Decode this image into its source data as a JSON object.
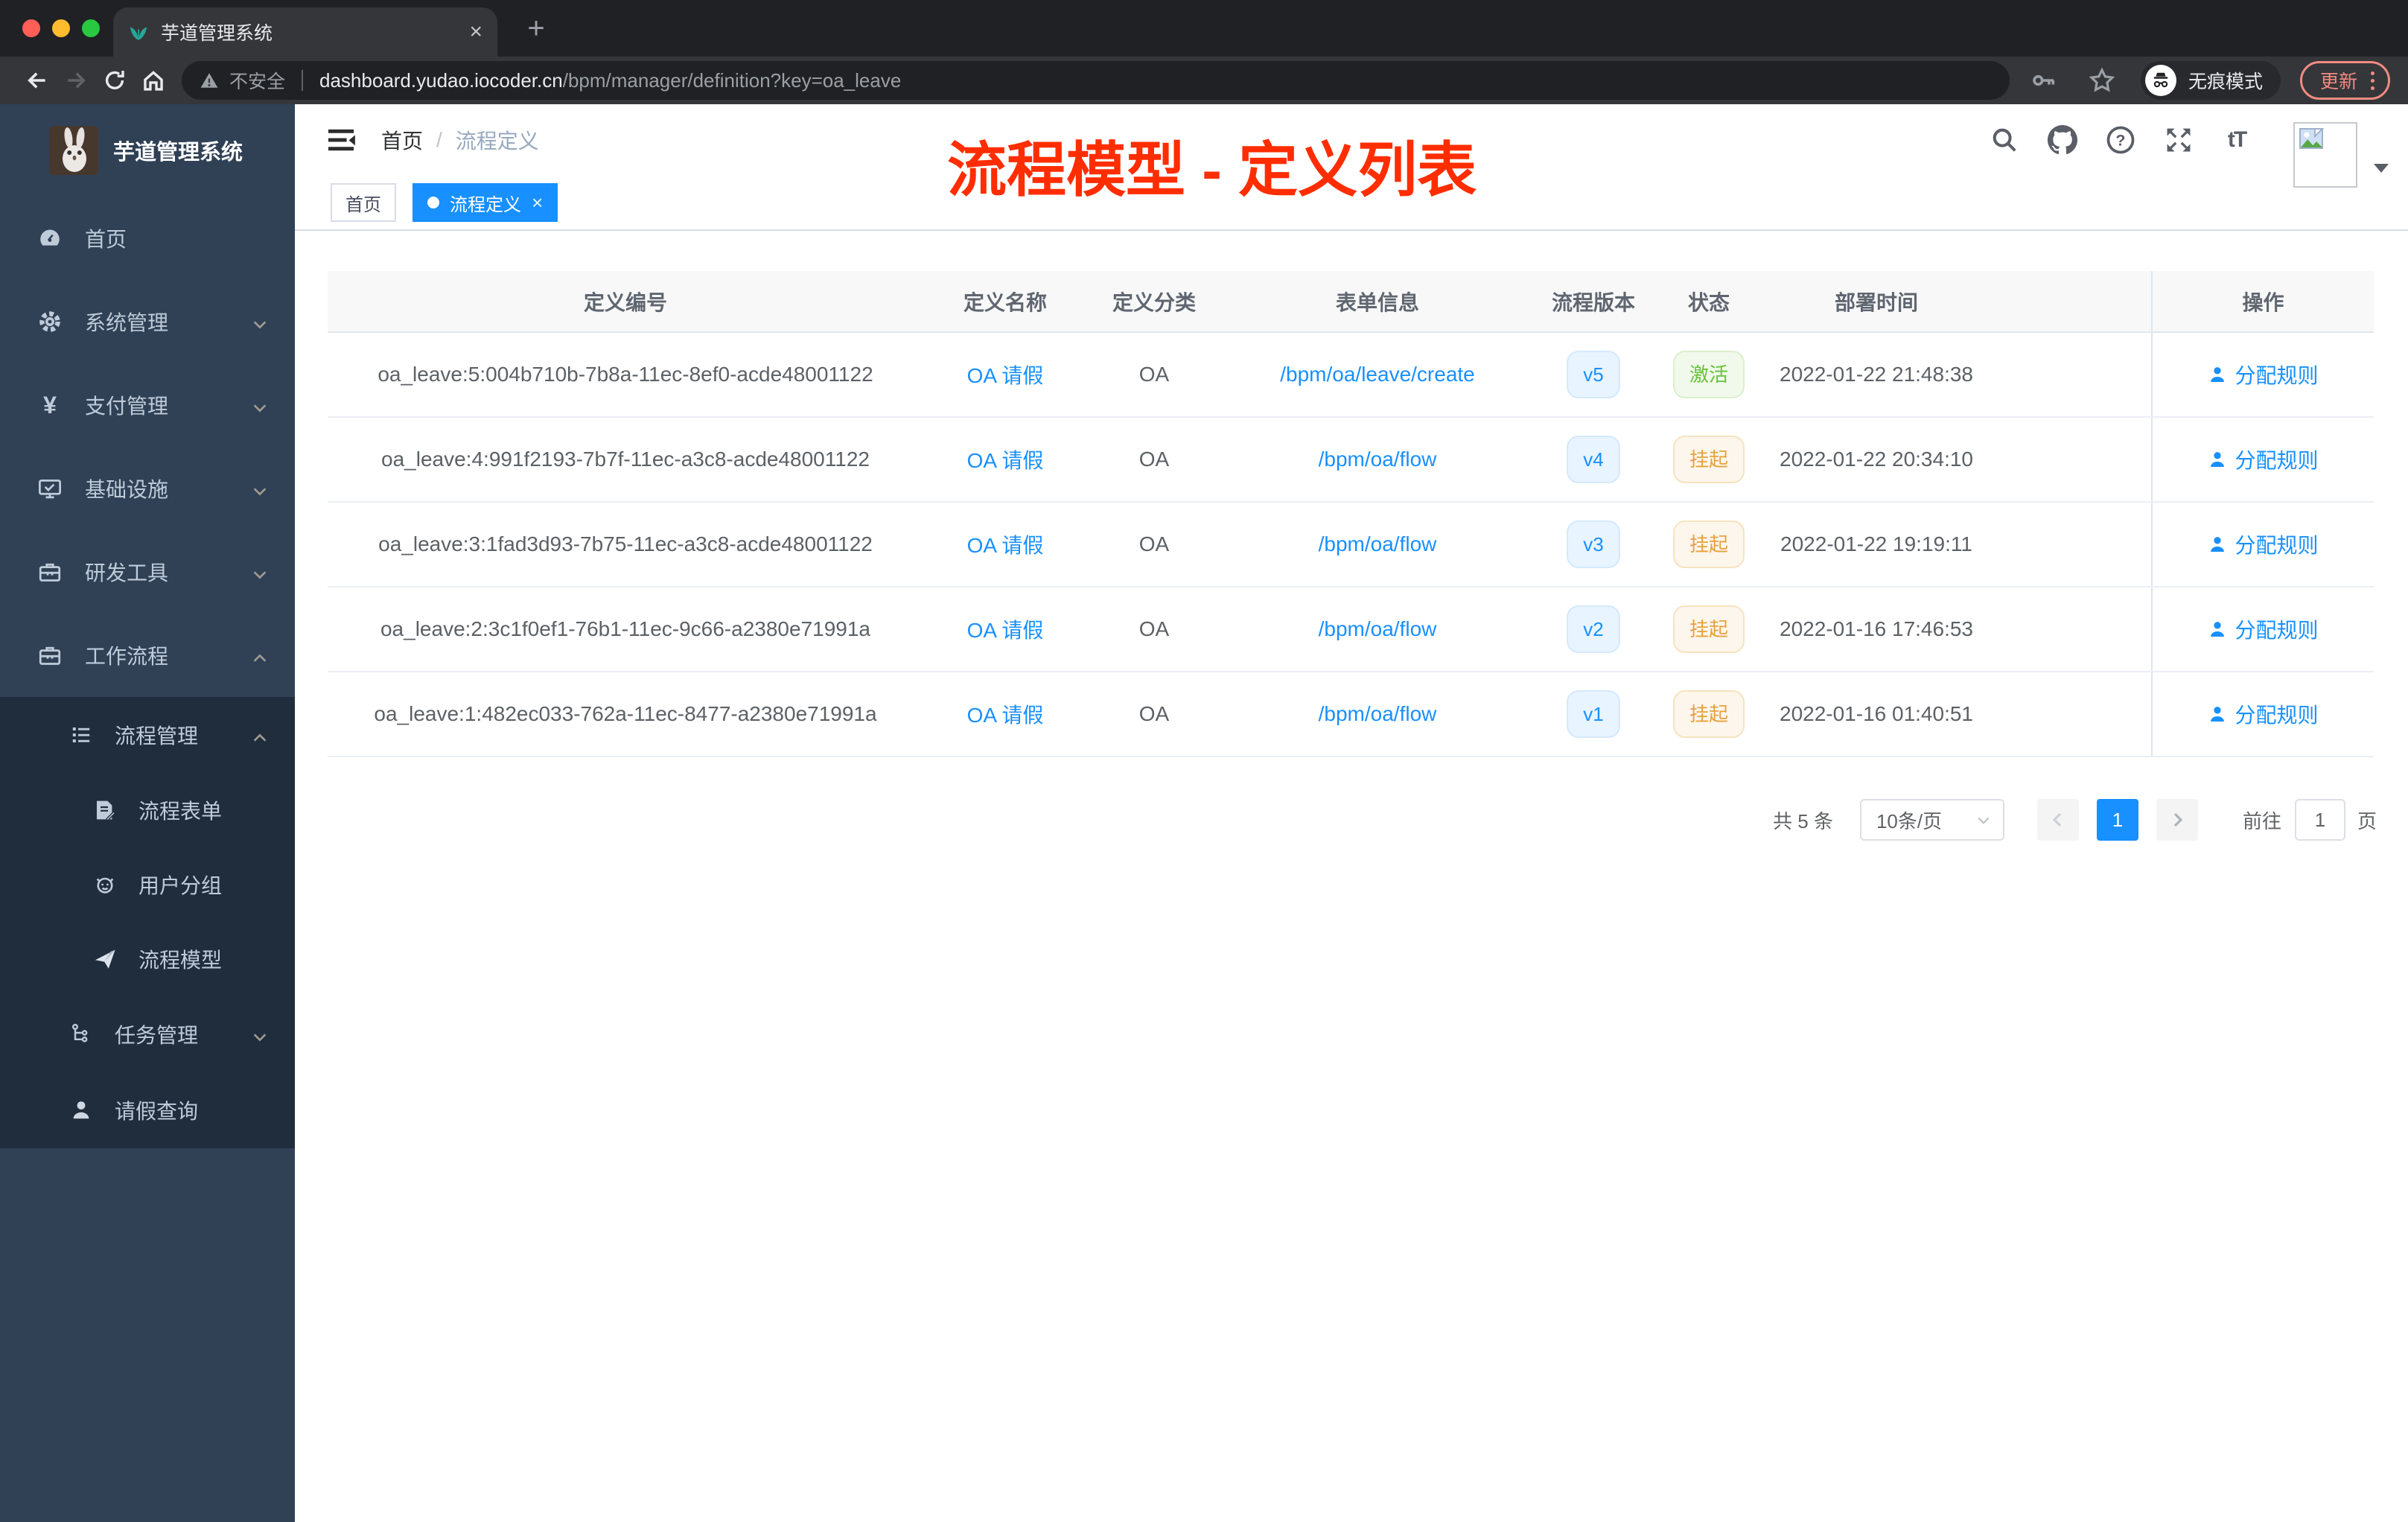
{
  "browser": {
    "traffic_lights": [
      "close",
      "minimize",
      "zoom"
    ],
    "tab": {
      "title": "芋道管理系统",
      "favicon": "sprout-icon",
      "close_glyph": "×",
      "new_tab_glyph": "+"
    },
    "address": {
      "security_label": "不安全",
      "host": "dashboard.yudao.iocoder.cn",
      "path": "/bpm/manager/definition?key=oa_leave"
    },
    "incognito_label": "无痕模式",
    "update_label": "更新"
  },
  "sidebar": {
    "logo_title": "芋道管理系统",
    "items": [
      {
        "label": "首页",
        "icon": "dashboard-icon",
        "chevron": null
      },
      {
        "label": "系统管理",
        "icon": "gear-icon",
        "chevron": "down"
      },
      {
        "label": "支付管理",
        "icon": "yen-icon",
        "chevron": "down"
      },
      {
        "label": "基础设施",
        "icon": "monitor-icon",
        "chevron": "down"
      },
      {
        "label": "研发工具",
        "icon": "toolbox-icon",
        "chevron": "down"
      },
      {
        "label": "工作流程",
        "icon": "briefcase-icon",
        "chevron": "up"
      }
    ],
    "submenu": [
      {
        "label": "流程管理",
        "icon": "list-tree-icon",
        "chevron": "up",
        "level": 2
      },
      {
        "label": "流程表单",
        "icon": "form-doc-icon",
        "chevron": null,
        "level": 3
      },
      {
        "label": "用户分组",
        "icon": "robot-icon",
        "chevron": null,
        "level": 3
      },
      {
        "label": "流程模型",
        "icon": "paper-plane-icon",
        "chevron": null,
        "level": 3
      },
      {
        "label": "任务管理",
        "icon": "task-tree-icon",
        "chevron": "down",
        "level": 2
      },
      {
        "label": "请假查询",
        "icon": "person-icon",
        "chevron": null,
        "level": 2
      }
    ]
  },
  "navbar": {
    "breadcrumb": {
      "home": "首页",
      "separator": "/",
      "current": "流程定义"
    },
    "icons": [
      "search-icon",
      "github-icon",
      "help-icon",
      "fullscreen-icon",
      "font-size-icon",
      "avatar",
      "caret-down-icon"
    ]
  },
  "tags_view": {
    "tabs": [
      {
        "label": "首页",
        "active": false
      },
      {
        "label": "流程定义",
        "active": true,
        "close_glyph": "×"
      }
    ]
  },
  "annotation": {
    "title": "流程模型 - 定义列表",
    "color": "#ff2d00"
  },
  "table": {
    "headers": [
      "定义编号",
      "定义名称",
      "定义分类",
      "表单信息",
      "流程版本",
      "状态",
      "部署时间",
      "操作"
    ],
    "rows": [
      {
        "id": "oa_leave:5:004b710b-7b8a-11ec-8ef0-acde48001122",
        "name": "OA 请假",
        "category": "OA",
        "form": "/bpm/oa/leave/create",
        "version": "v5",
        "status": "激活",
        "status_type": "success",
        "deploy_time": "2022-01-22 21:48:38",
        "action": "分配规则"
      },
      {
        "id": "oa_leave:4:991f2193-7b7f-11ec-a3c8-acde48001122",
        "name": "OA 请假",
        "category": "OA",
        "form": "/bpm/oa/flow",
        "version": "v4",
        "status": "挂起",
        "status_type": "warning",
        "deploy_time": "2022-01-22 20:34:10",
        "action": "分配规则"
      },
      {
        "id": "oa_leave:3:1fad3d93-7b75-11ec-a3c8-acde48001122",
        "name": "OA 请假",
        "category": "OA",
        "form": "/bpm/oa/flow",
        "version": "v3",
        "status": "挂起",
        "status_type": "warning",
        "deploy_time": "2022-01-22 19:19:11",
        "action": "分配规则"
      },
      {
        "id": "oa_leave:2:3c1f0ef1-76b1-11ec-9c66-a2380e71991a",
        "name": "OA 请假",
        "category": "OA",
        "form": "/bpm/oa/flow",
        "version": "v2",
        "status": "挂起",
        "status_type": "warning",
        "deploy_time": "2022-01-16 17:46:53",
        "action": "分配规则"
      },
      {
        "id": "oa_leave:1:482ec033-762a-11ec-8477-a2380e71991a",
        "name": "OA 请假",
        "category": "OA",
        "form": "/bpm/oa/flow",
        "version": "v1",
        "status": "挂起",
        "status_type": "warning",
        "deploy_time": "2022-01-16 01:40:51",
        "action": "分配规则"
      }
    ]
  },
  "pagination": {
    "total": "共 5 条",
    "page_size": "10条/页",
    "current_page": "1",
    "goto_label": "前往",
    "goto_value": "1",
    "page_unit": "页"
  },
  "colors": {
    "accent": "#1890ff",
    "annotation_red": "#ff2d00",
    "success": "#67c23a",
    "warning": "#e6a23c",
    "sidebar_bg": "#304156",
    "submenu_bg": "#1f2d3d",
    "chrome_dark": "#202124",
    "chrome_bar": "#35363a"
  }
}
